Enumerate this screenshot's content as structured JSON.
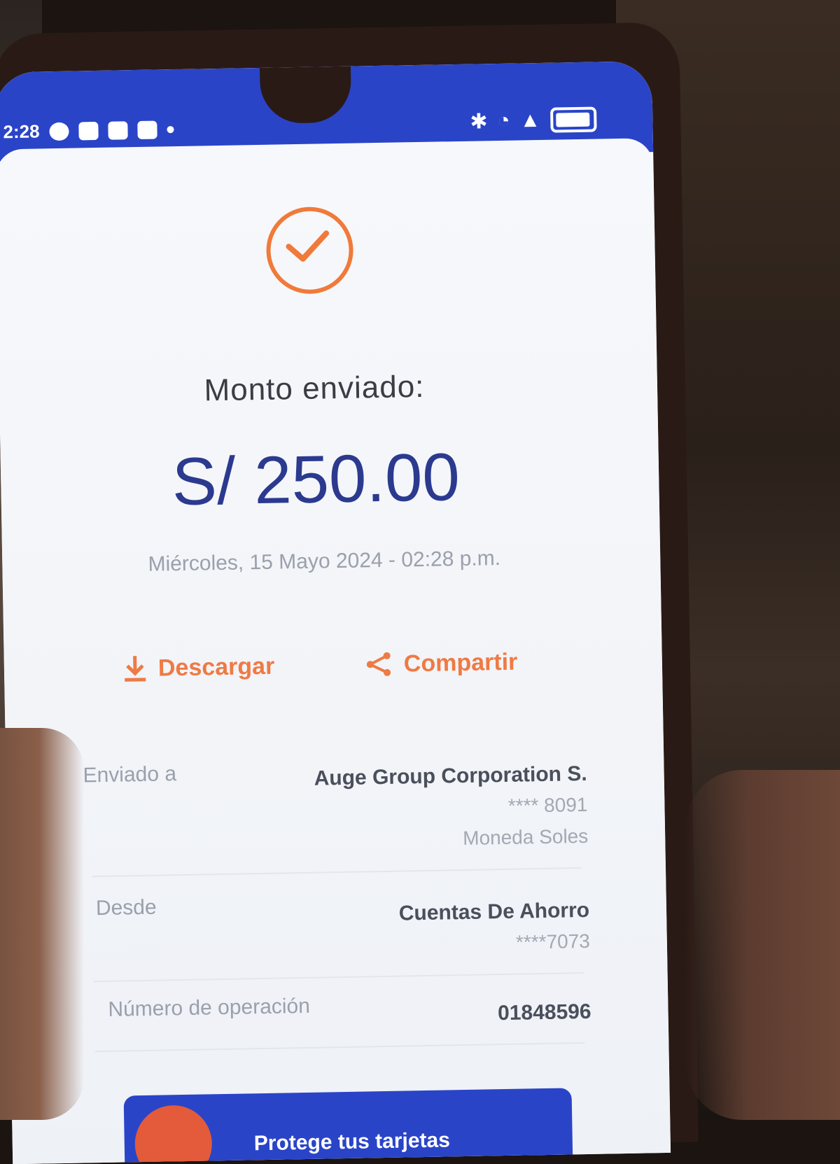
{
  "status": {
    "time": "2:28",
    "icons_left": [
      "messenger-icon",
      "gallery-icon",
      "tiktok-icon",
      "youtube-icon"
    ],
    "icons_right": [
      "bluetooth-icon",
      "wifi-icon",
      "signal-icon",
      "battery-icon"
    ]
  },
  "receipt": {
    "title": "Monto enviado:",
    "amount": "S/ 250.00",
    "datetime": "Miércoles, 15 Mayo 2024 - 02:28 p.m."
  },
  "actions": {
    "download_label": "Descargar",
    "share_label": "Compartir"
  },
  "details": {
    "sent_to_label": "Enviado a",
    "sent_to_name": "Auge Group Corporation S.",
    "sent_to_account": "**** 8091",
    "sent_to_currency": "Moneda Soles",
    "from_label": "Desde",
    "from_account_type": "Cuentas De Ahorro",
    "from_account_number": "****7073",
    "operation_label": "Número de operación",
    "operation_number": "01848596"
  },
  "banner": {
    "text": "Protege tus tarjetas"
  },
  "colors": {
    "brand_blue": "#2a44c8",
    "accent_orange": "#f07a3a",
    "amount_blue": "#2b3a8f"
  }
}
